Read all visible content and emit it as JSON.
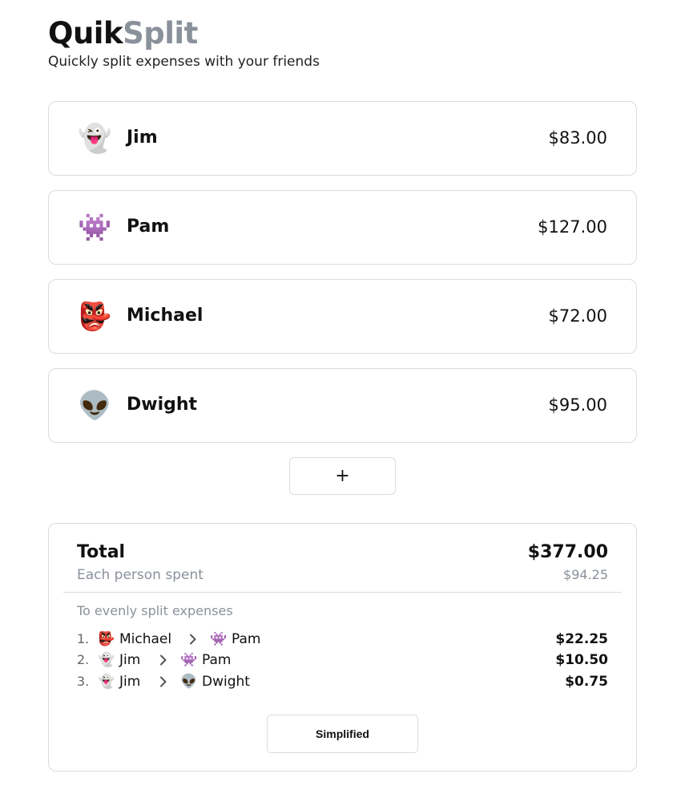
{
  "brand": {
    "part1": "Quik",
    "part2": "Split",
    "tagline": "Quickly split expenses with your friends"
  },
  "people": [
    {
      "emoji": "👻",
      "icon": "ghost-icon",
      "name": "Jim",
      "amount": "$83.00"
    },
    {
      "emoji": "👾",
      "icon": "space-invader-icon",
      "name": "Pam",
      "amount": "$127.00"
    },
    {
      "emoji": "👺",
      "icon": "goblin-mask-icon",
      "name": "Michael",
      "amount": "$72.00"
    },
    {
      "emoji": "👽",
      "icon": "alien-icon",
      "name": "Dwight",
      "amount": "$95.00"
    }
  ],
  "add_button": {
    "label": "+"
  },
  "summary": {
    "total_label": "Total",
    "total_amount": "$377.00",
    "each_label": "Each person spent",
    "each_amount": "$94.25",
    "split_title": "To evenly split expenses",
    "transactions": [
      {
        "index": "1.",
        "from_emoji": "👺",
        "from": "Michael",
        "to_emoji": "👾",
        "to": "Pam",
        "amount": "$22.25"
      },
      {
        "index": "2.",
        "from_emoji": "👻",
        "from": "Jim",
        "to_emoji": "👾",
        "to": "Pam",
        "amount": "$10.50"
      },
      {
        "index": "3.",
        "from_emoji": "👻",
        "from": "Jim",
        "to_emoji": "👽",
        "to": "Dwight",
        "amount": "$0.75"
      }
    ],
    "mode_button": "Simplified"
  }
}
